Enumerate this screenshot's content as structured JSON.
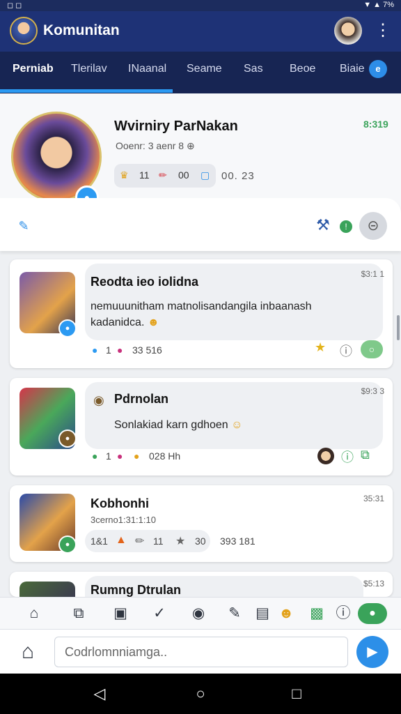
{
  "app": {
    "title": "Komunitan"
  },
  "tabs": [
    {
      "label": "Perniab",
      "active": true
    },
    {
      "label": "Tlerilav"
    },
    {
      "label": "INaanal"
    },
    {
      "label": "Seame"
    },
    {
      "label": "Sas"
    },
    {
      "label": "Beoe"
    },
    {
      "label": "Biaie",
      "badge": "e"
    }
  ],
  "profile": {
    "name": "Wvirniry ParNakan",
    "subtitle": "Ooenr: 3 aenr 8 ⊕",
    "count": "8:319",
    "stats": {
      "a": "11",
      "b": "00"
    },
    "stat_extra": "00. 23"
  },
  "posts": [
    {
      "title": "Reodta ieo iolidna",
      "text_line1": "nemuuunitham matnolisandangila inbaanash",
      "text_line2": "kadanidca.",
      "time": "$3:1 1",
      "meta_a": "1",
      "meta_b": "33  516"
    },
    {
      "title": "Pdrnolan",
      "text_line1": "Sonlakiad karn gdhoen",
      "time": "$9:3 3",
      "meta_a": "1",
      "meta_b": "028  Hh"
    },
    {
      "title": "Kobhonhi",
      "subtitle": "3cerno1:31:1:10",
      "time": "35:31",
      "meta_a": "1&1",
      "meta_b": "11",
      "meta_c": "30",
      "meta_d": "393  181"
    },
    {
      "title": "Rumng Dtrulan",
      "time": "$5:13"
    }
  ],
  "composer": {
    "placeholder": "Codrlomnniamga.."
  },
  "colors": {
    "primary": "#1e3276",
    "accent": "#2c9af2",
    "green": "#3aa35a"
  }
}
